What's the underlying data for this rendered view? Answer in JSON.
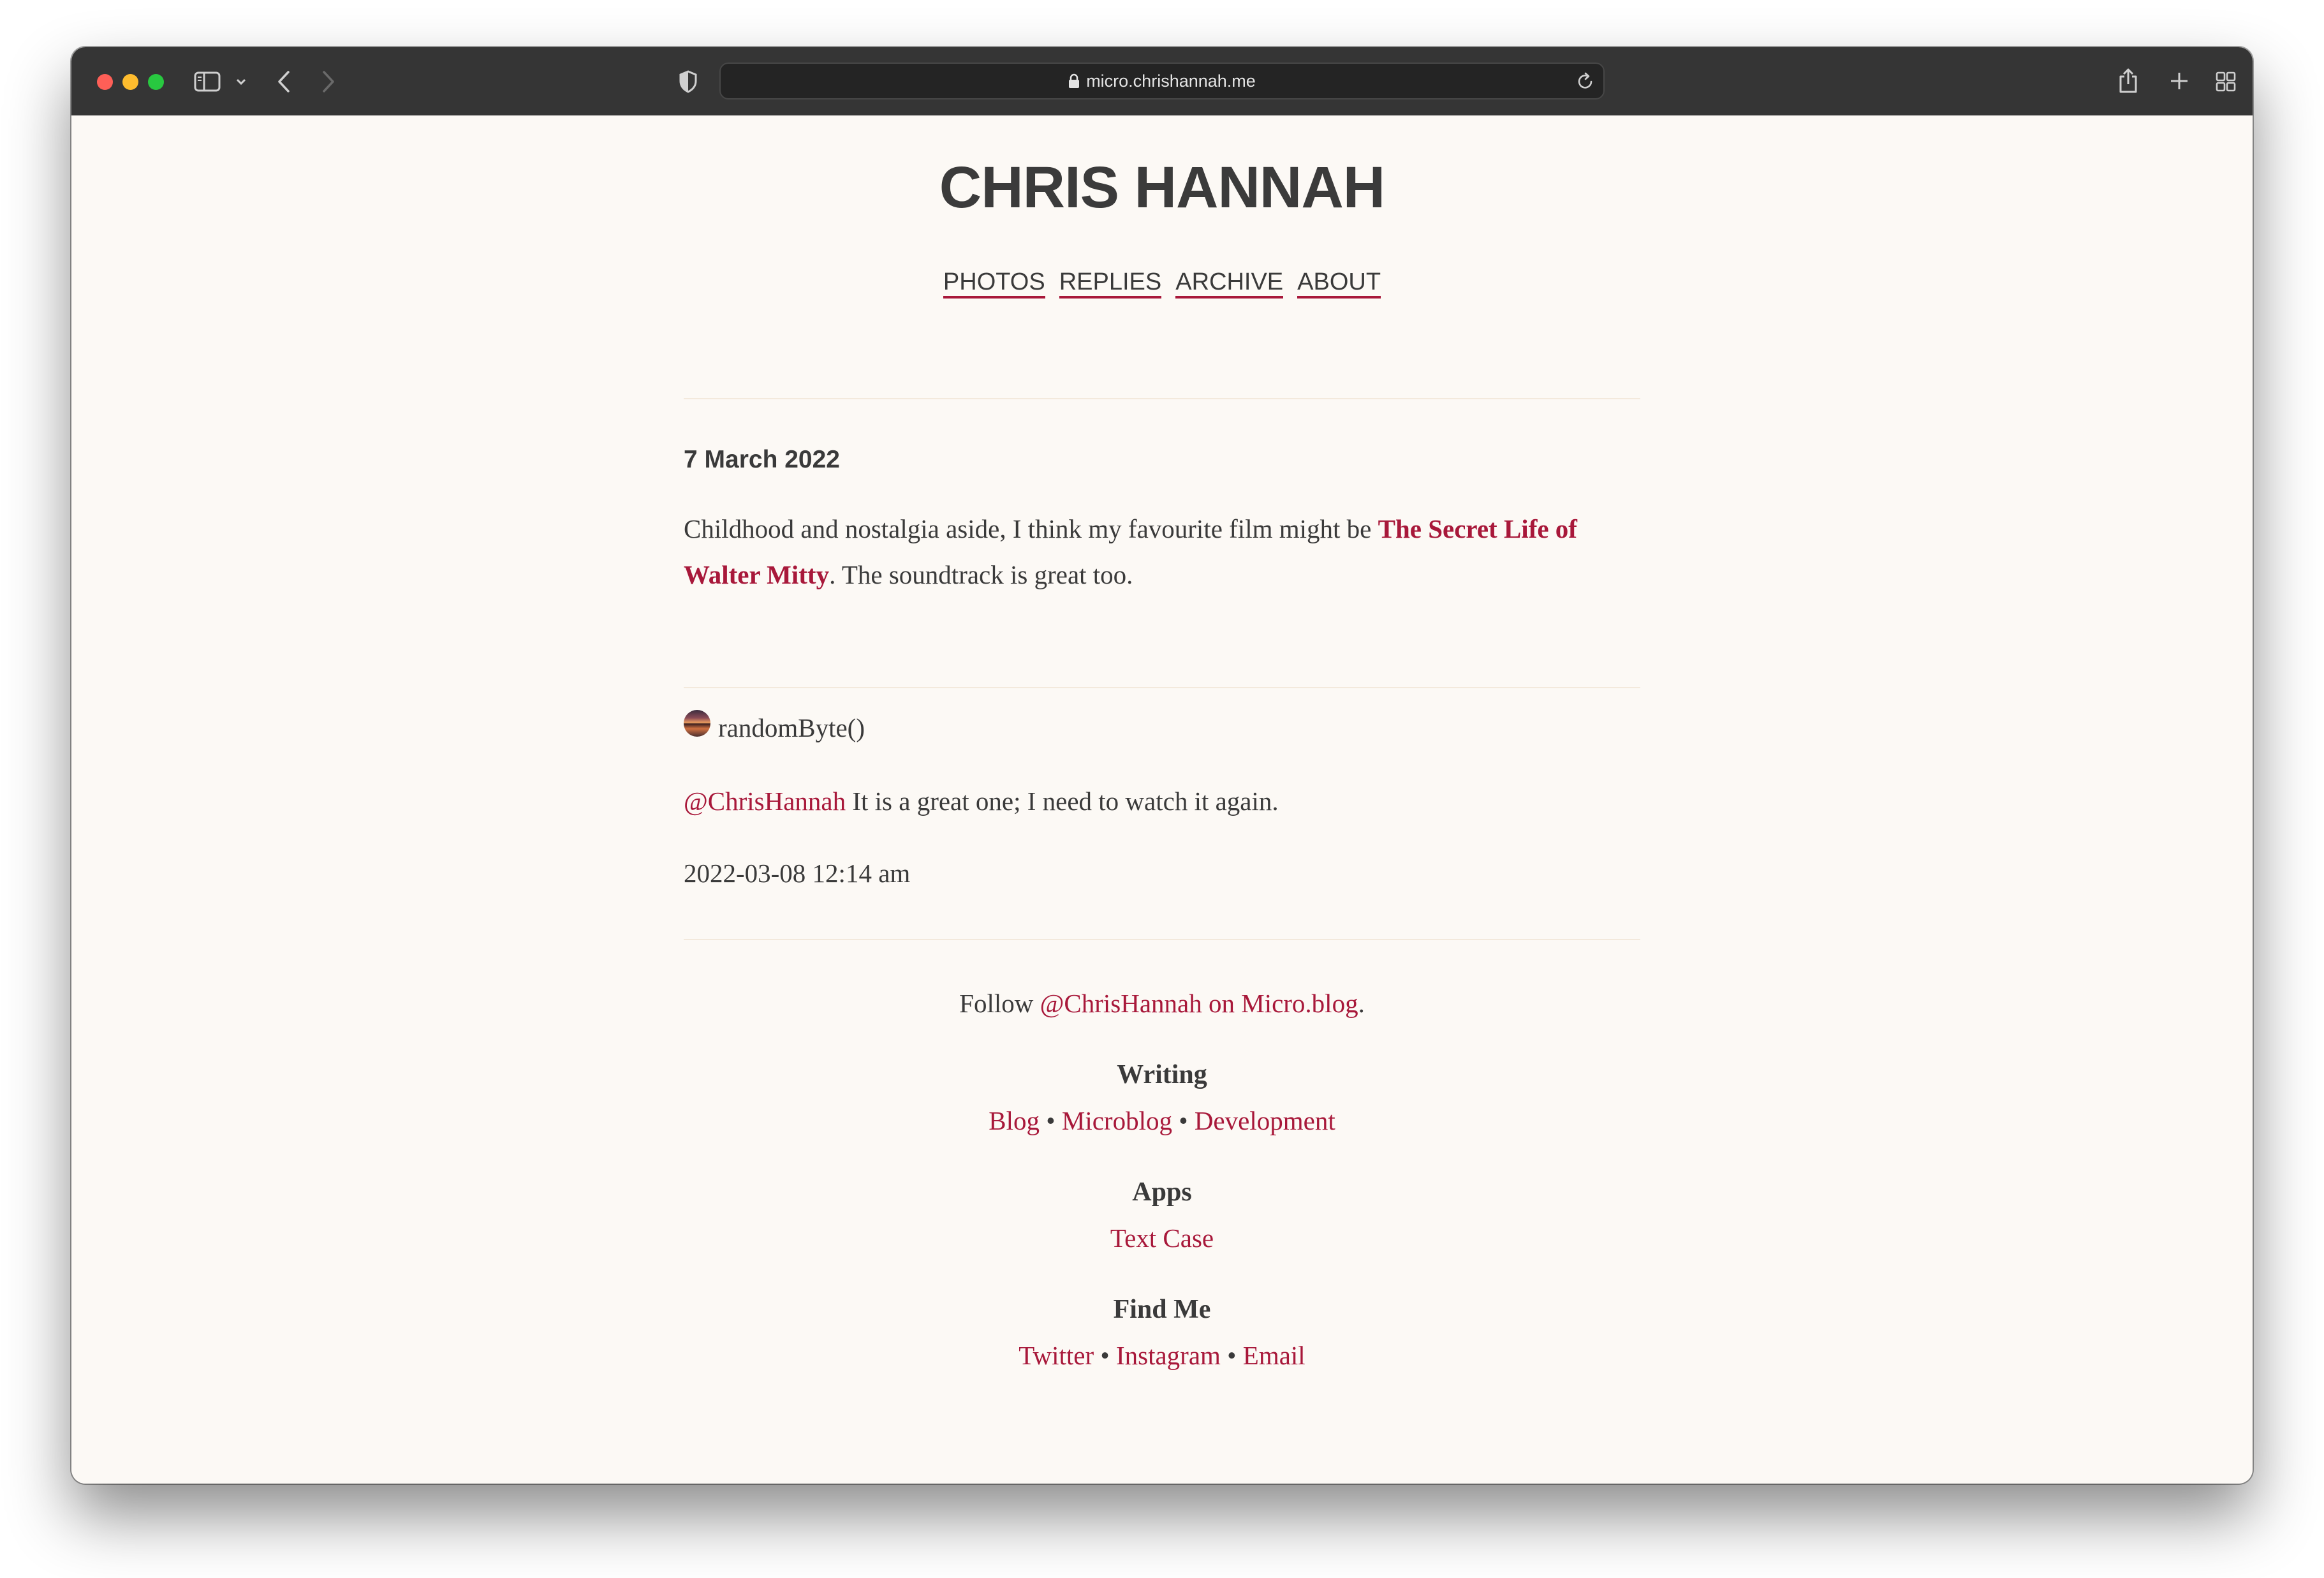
{
  "browser": {
    "url": "micro.chrishannah.me"
  },
  "site": {
    "title": "CHRIS HANNAH",
    "nav": [
      "PHOTOS",
      "REPLIES",
      "ARCHIVE",
      "ABOUT"
    ]
  },
  "post": {
    "date": "7 March 2022",
    "text_before": "Childhood and nostalgia aside, I think my favourite film might be ",
    "film_link": "The Secret Life of Walter Mitty",
    "text_after": ". The soundtrack is great too."
  },
  "reply": {
    "author": "randomByte()",
    "mention": "@ChrisHannah",
    "text": " It is a great one; I need to watch it again.",
    "timestamp": "2022-03-08 12:14 am"
  },
  "footer": {
    "follow_prefix": "Follow ",
    "follow_link": "@ChrisHannah on Micro.blog",
    "follow_suffix": ".",
    "separator": " • ",
    "sections": [
      {
        "heading": "Writing",
        "links": [
          "Blog",
          "Microblog",
          "Development"
        ]
      },
      {
        "heading": "Apps",
        "links": [
          "Text Case"
        ]
      },
      {
        "heading": "Find Me",
        "links": [
          "Twitter",
          "Instagram",
          "Email"
        ]
      }
    ]
  }
}
